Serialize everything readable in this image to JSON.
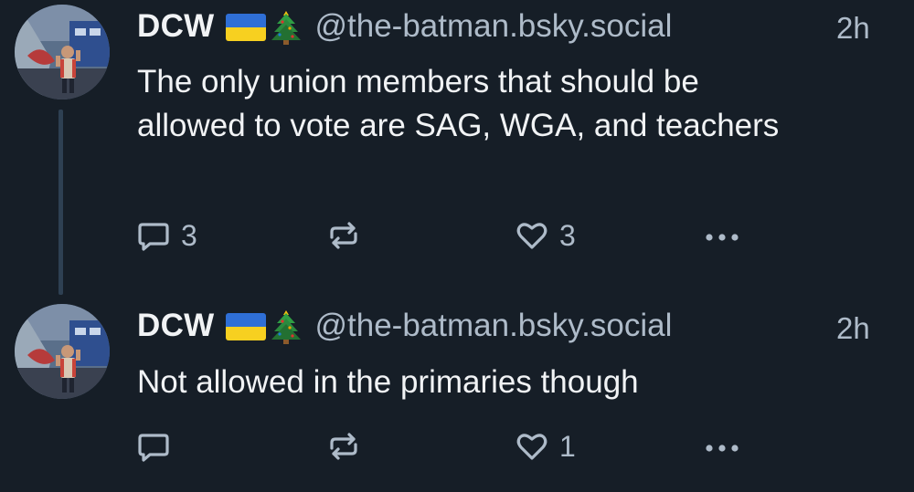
{
  "posts": [
    {
      "author": {
        "display_name": "DCW",
        "flag_icon": "ukraine-flag-icon",
        "emoji_icon": "christmas-tree-icon",
        "handle": "@the-batman.bsky.social"
      },
      "timestamp": "2h",
      "text": "The only union members that should be allowed to vote are SAG, WGA, and teachers",
      "actions": {
        "reply_count": "3",
        "repost_count": "",
        "like_count": "3"
      },
      "has_thread_line": true
    },
    {
      "author": {
        "display_name": "DCW",
        "flag_icon": "ukraine-flag-icon",
        "emoji_icon": "christmas-tree-icon",
        "handle": "@the-batman.bsky.social"
      },
      "timestamp": "2h",
      "text": "Not allowed in the primaries though",
      "actions": {
        "reply_count": "",
        "repost_count": "",
        "like_count": "1"
      },
      "has_thread_line": false
    }
  ],
  "colors": {
    "background": "#161e27",
    "text_primary": "#f1f3f5",
    "text_secondary": "#aebbc9",
    "thread_line": "#2e4052"
  }
}
